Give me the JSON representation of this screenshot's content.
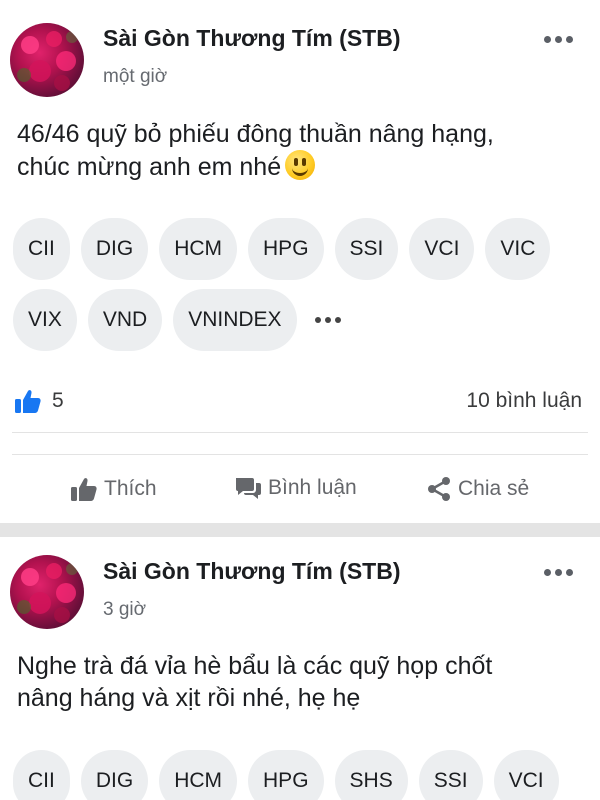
{
  "posts": [
    {
      "author": "Sài Gòn Thương Tím (STB)",
      "time": "một giờ",
      "text_line1": "46/46 quỹ bỏ phiếu đông thuần nâng hạng,",
      "text_line2": "chúc mừng anh em nhé",
      "tags": [
        "CII",
        "DIG",
        "HCM",
        "HPG",
        "SSI",
        "VCI",
        "VIC",
        "VIX",
        "VND",
        "VNINDEX"
      ],
      "like_count": "5",
      "comment_count": "10 bình luận",
      "actions": {
        "like": "Thích",
        "comment": "Bình luận",
        "share": "Chia sẻ"
      }
    },
    {
      "author": "Sài Gòn Thương Tím (STB)",
      "time": "3 giờ",
      "text_line1": "Nghe trà đá vỉa hè bẩu là các quỹ họp chốt",
      "text_line2": "nâng háng và xịt rồi nhé, hẹ hẹ",
      "tags": [
        "CII",
        "DIG",
        "HCM",
        "HPG",
        "SHS",
        "SSI",
        "VCI"
      ]
    }
  ],
  "icons": {
    "more": "more-horizontal-icon",
    "like_blue": "thumbs-up-filled-icon",
    "like_action": "thumbs-up-icon",
    "comment_action": "speech-bubbles-icon",
    "share_action": "share-nodes-icon",
    "emoji": "grinning-face-icon"
  },
  "colors": {
    "accent": "#1877f2",
    "tag_bg": "#eceef0",
    "separator": "#e4e4e4",
    "muted_text": "#65676b"
  }
}
